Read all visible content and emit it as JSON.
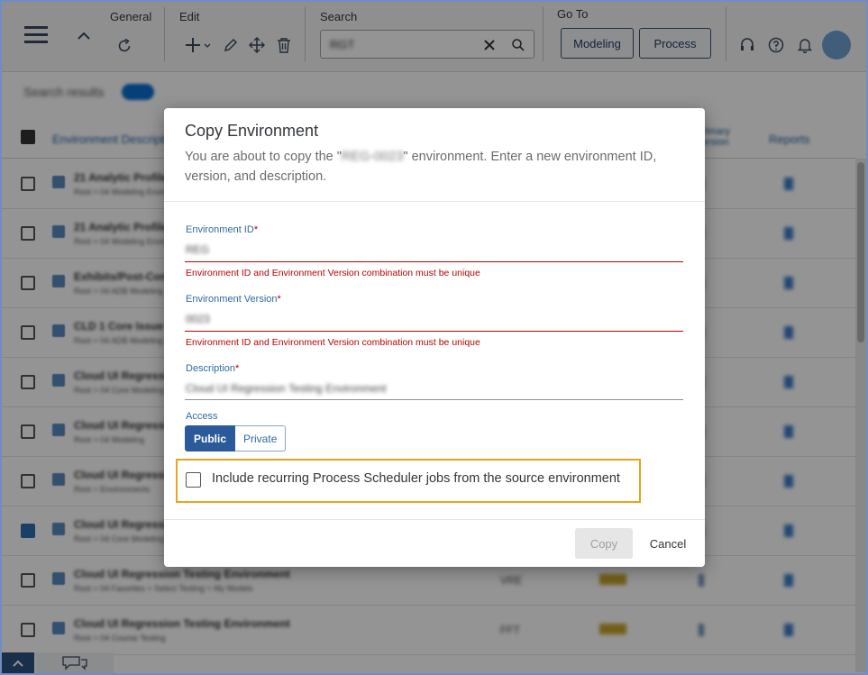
{
  "toolbar": {
    "general_label": "General",
    "edit_label": "Edit",
    "search_label": "Search",
    "goto_label": "Go To",
    "search_value": "RGT",
    "modeling_label": "Modeling",
    "process_label": "Process"
  },
  "content": {
    "results_label": "Search results",
    "columns": [
      "Environment Description",
      "Primary Version",
      "Reports"
    ],
    "rows": [
      {
        "title": "21 Analytic Profile",
        "sub": "Root > 04 Modeling Environments",
        "num": "",
        "checked": false
      },
      {
        "title": "21 Analytic Profile",
        "sub": "Root > 04 Modeling Environments",
        "num": "",
        "checked": false
      },
      {
        "title": "Exhibits/Post-Cond",
        "sub": "Root > 04 ADB Modeling",
        "num": "",
        "checked": false
      },
      {
        "title": "CLD 1 Core Issue",
        "sub": "Root > 04 ADB Modeling",
        "num": "",
        "checked": false
      },
      {
        "title": "Cloud UI Regression",
        "sub": "Root > 04 Core Modeling",
        "num": "",
        "checked": false
      },
      {
        "title": "Cloud UI Regression",
        "sub": "Root > 04 Modeling",
        "num": "",
        "checked": false
      },
      {
        "title": "Cloud UI Regression",
        "sub": "Root > Environments",
        "num": "",
        "checked": false
      },
      {
        "title": "Cloud UI Regression",
        "sub": "Root > 04 Core Modeling",
        "num": "",
        "checked": true
      },
      {
        "title": "Cloud UI Regression Testing Environment",
        "sub": "Root > 04 Favorites > Select Testing > My Models",
        "num": "VRE",
        "checked": false
      },
      {
        "title": "Cloud UI Regression Testing Environment",
        "sub": "Root > 04 Course Testing",
        "num": "FFT",
        "checked": false
      }
    ]
  },
  "dialog": {
    "title": "Copy Environment",
    "desc_before": "You are about to copy the \"",
    "desc_env": "REG-0023",
    "desc_after": "\" environment. Enter a new environment ID, version, and description.",
    "env_id_label": "Environment ID",
    "env_id_value": "REG",
    "env_id_error": "Environment ID and Environment Version combination must be unique",
    "env_version_label": "Environment Version",
    "env_version_value": "0023",
    "env_version_error": "Environment ID and Environment Version combination must be unique",
    "description_label": "Description",
    "description_value": "Cloud UI Regression Testing Environment",
    "required_mark": "*",
    "access_label": "Access",
    "access_public": "Public",
    "access_private": "Private",
    "include_jobs_label": "Include recurring Process Scheduler jobs from the source environment",
    "copy_label": "Copy",
    "cancel_label": "Cancel"
  },
  "colors": {
    "accent": "#2b5a9a",
    "error": "#bb0000",
    "highlight": "#e8a41c"
  }
}
